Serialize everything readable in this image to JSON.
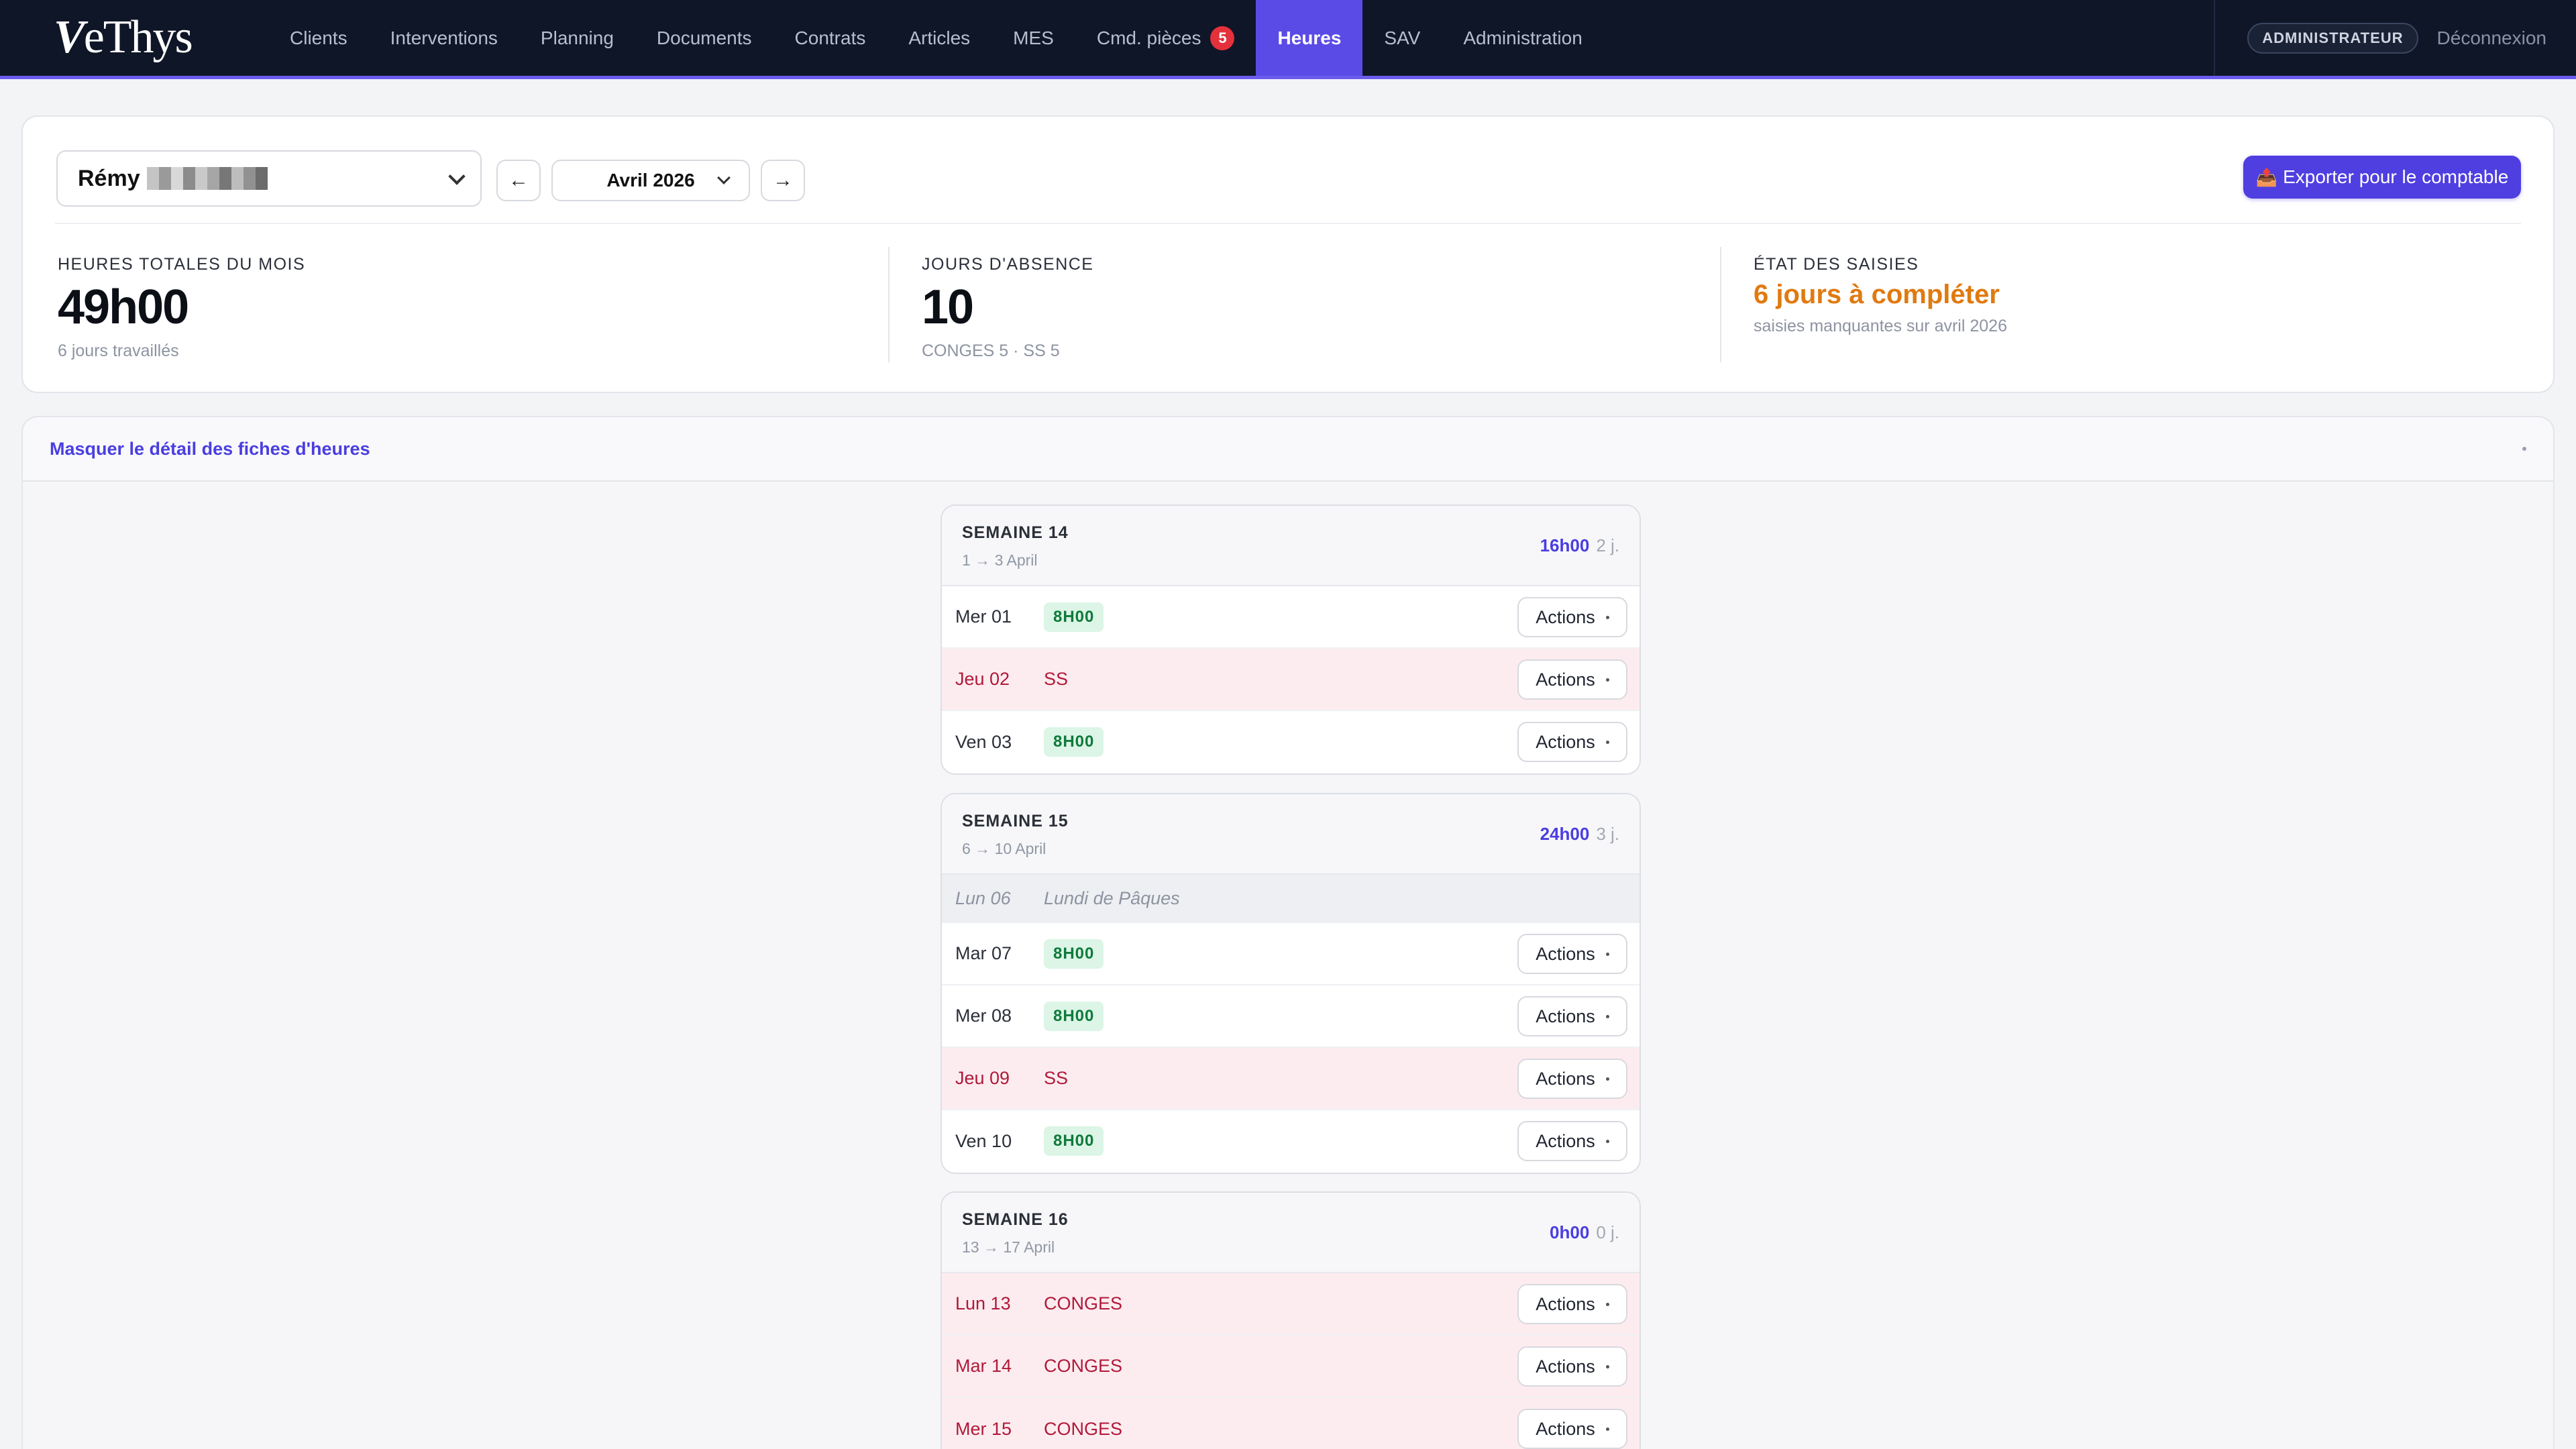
{
  "brand": {
    "logo_v": "V",
    "logo_rest": "eThys"
  },
  "nav": {
    "items": [
      {
        "label": "Clients"
      },
      {
        "label": "Interventions"
      },
      {
        "label": "Planning"
      },
      {
        "label": "Documents"
      },
      {
        "label": "Contrats"
      },
      {
        "label": "Articles"
      },
      {
        "label": "MES"
      },
      {
        "label": "Cmd. pièces",
        "badge": "5"
      },
      {
        "label": "Heures",
        "active": true
      },
      {
        "label": "SAV"
      },
      {
        "label": "Administration"
      }
    ],
    "role": "ADMINISTRATEUR",
    "logout": "Déconnexion"
  },
  "toolbar": {
    "employee_first_name": "Rémy",
    "month": "Avril 2026",
    "prev_arrow": "←",
    "next_arrow": "→",
    "export_icon": "📤",
    "export_label": "Exporter pour le comptable"
  },
  "stats": {
    "total": {
      "label": "HEURES TOTALES DU MOIS",
      "value": "49h00",
      "sub": "6 jours travaillés"
    },
    "absence": {
      "label": "JOURS D'ABSENCE",
      "value": "10",
      "sub": "CONGES 5 · SS 5"
    },
    "status": {
      "label": "ÉTAT DES SAISIES",
      "value": "6 jours à compléter",
      "sub": "saisies manquantes sur avril 2026"
    }
  },
  "detail": {
    "toggle_label": "Masquer le détail des fiches d'heures",
    "actions_label": "Actions",
    "weeks": [
      {
        "title": "SEMAINE 14",
        "range": "1 → 3 April",
        "hours": "16h00",
        "days": "2 j.",
        "rows": [
          {
            "day": "Mer 01",
            "type": "hours",
            "value": "8H00"
          },
          {
            "day": "Jeu 02",
            "type": "absence",
            "value": "SS"
          },
          {
            "day": "Ven 03",
            "type": "hours",
            "value": "8H00"
          }
        ]
      },
      {
        "title": "SEMAINE 15",
        "range": "6 → 10 April",
        "hours": "24h00",
        "days": "3 j.",
        "rows": [
          {
            "day": "Lun 06",
            "type": "holiday",
            "value": "Lundi de Pâques"
          },
          {
            "day": "Mar 07",
            "type": "hours",
            "value": "8H00"
          },
          {
            "day": "Mer 08",
            "type": "hours",
            "value": "8H00"
          },
          {
            "day": "Jeu 09",
            "type": "absence",
            "value": "SS"
          },
          {
            "day": "Ven 10",
            "type": "hours",
            "value": "8H00"
          }
        ]
      },
      {
        "title": "SEMAINE 16",
        "range": "13 → 17 April",
        "hours": "0h00",
        "days": "0 j.",
        "rows": [
          {
            "day": "Lun 13",
            "type": "absence",
            "value": "CONGES"
          },
          {
            "day": "Mar 14",
            "type": "absence",
            "value": "CONGES"
          },
          {
            "day": "Mer 15",
            "type": "absence",
            "value": "CONGES"
          }
        ]
      }
    ]
  },
  "colors": {
    "accent": "#5b4be6",
    "nav_bg": "#0f1628",
    "warn": "#e07a10",
    "absence": "#b0193a",
    "hours_badge": "#dcf5e6"
  }
}
